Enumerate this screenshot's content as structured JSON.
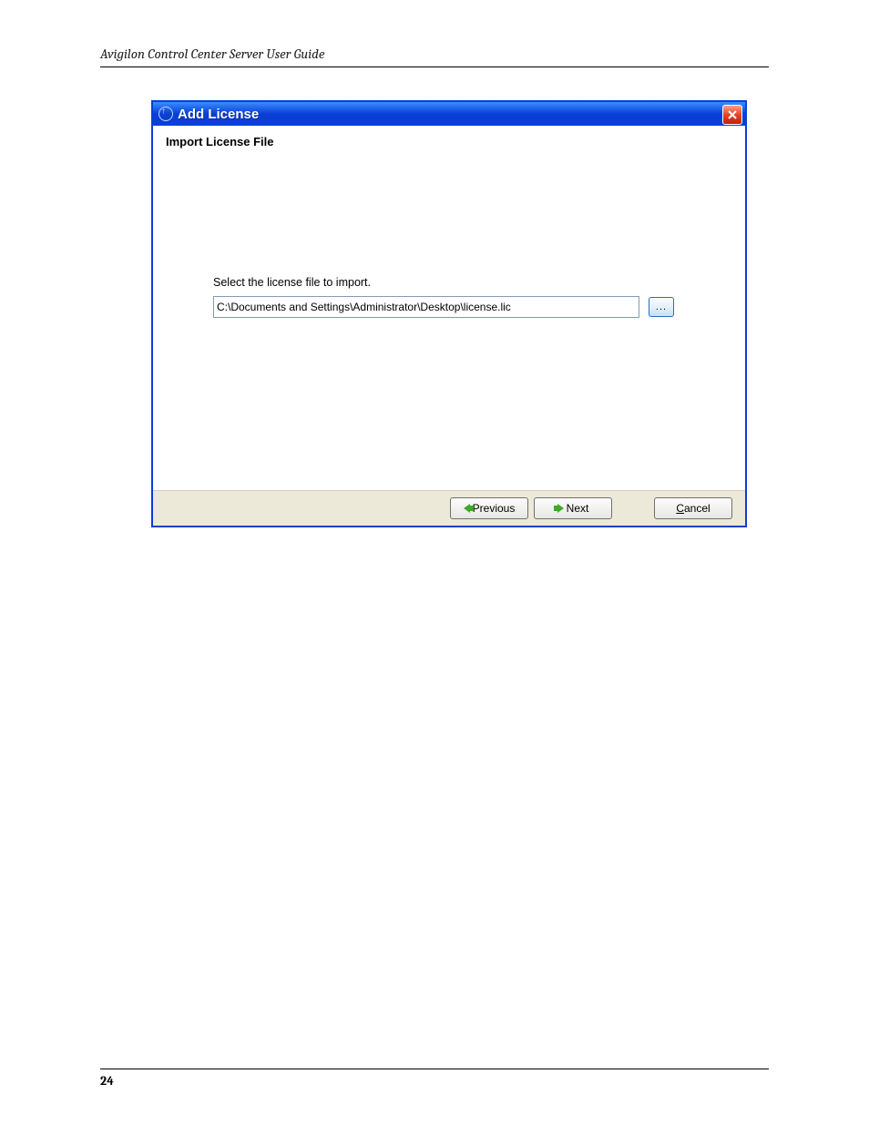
{
  "doc_header": "Avigilon Control Center Server User Guide",
  "page_number": "24",
  "dialog": {
    "title": "Add License",
    "section_title": "Import License File",
    "instruction": "Select the license file to import.",
    "file_path": "C:\\Documents and Settings\\Administrator\\Desktop\\license.lic",
    "browse_label": "...",
    "buttons": {
      "previous": "Previous",
      "next": "Next",
      "cancel_prefix": "C",
      "cancel_rest": "ancel"
    }
  }
}
